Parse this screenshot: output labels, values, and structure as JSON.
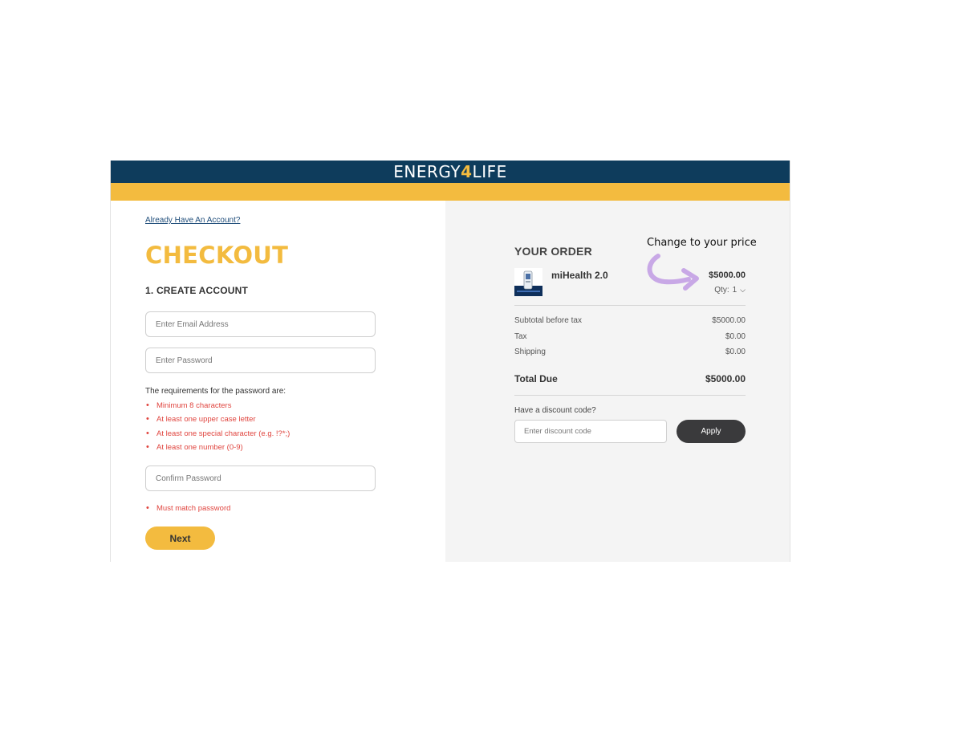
{
  "header": {
    "logo_part1": "ENERGY",
    "logo_part2": "4",
    "logo_part3": "LIFE",
    "colors": {
      "navy": "#0e3c5c",
      "gold": "#f3bb3f",
      "error": "#e0453f"
    }
  },
  "account": {
    "login_link": "Already Have An Account?",
    "title": "CHECKOUT",
    "step_title": "1.  CREATE ACCOUNT",
    "email_placeholder": "Enter Email Address",
    "password_placeholder": "Enter Password",
    "requirements_heading": "The requirements for the password are:",
    "requirements": [
      "Minimum 8 characters",
      "At least one upper case letter",
      "At least one special character (e.g. !?*;)",
      "At least one number (0-9)"
    ],
    "confirm_placeholder": "Confirm Password",
    "confirm_rule": "Must match password",
    "next_label": "Next"
  },
  "order": {
    "title": "YOUR ORDER",
    "product_name": "miHealth 2.0",
    "product_price": "$5000.00",
    "qty_label": "Qty:",
    "qty_value": "1",
    "summary": [
      {
        "label": "Subtotal before tax",
        "value": "$5000.00"
      },
      {
        "label": "Tax",
        "value": "$0.00"
      },
      {
        "label": "Shipping",
        "value": "$0.00"
      }
    ],
    "total_label": "Total Due",
    "total_value": "$5000.00",
    "discount_label": "Have a discount code?",
    "discount_placeholder": "Enter discount code",
    "apply_label": "Apply"
  },
  "annotation": {
    "text": "Change to your price",
    "arrow_color": "#c8a8e6"
  }
}
